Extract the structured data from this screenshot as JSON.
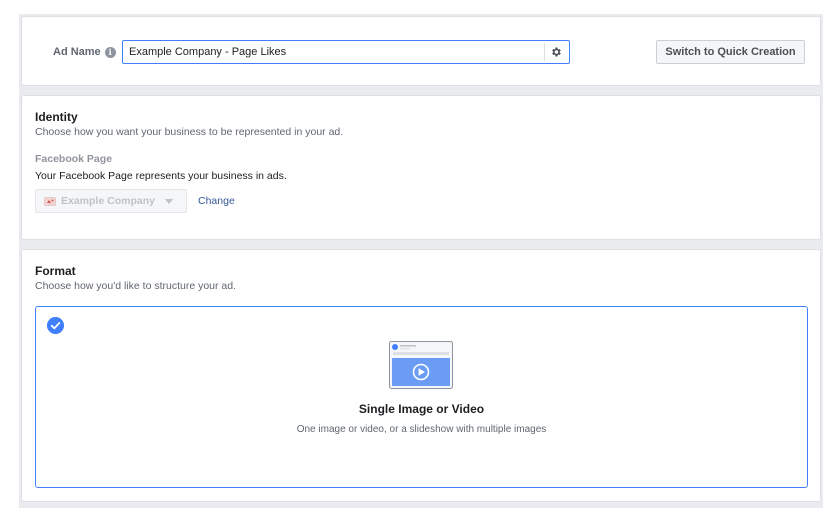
{
  "ad_name": {
    "label": "Ad Name",
    "value": "Example Company - Page Likes",
    "quick_creation_button": "Switch to Quick Creation"
  },
  "identity": {
    "title": "Identity",
    "subtitle": "Choose how you want your business to be represented in your ad.",
    "facebook_page_label": "Facebook Page",
    "facebook_page_description": "Your Facebook Page represents your business in ads.",
    "selected_page": "Example Company",
    "change_link": "Change"
  },
  "format": {
    "title": "Format",
    "subtitle": "Choose how you'd like to structure your ad.",
    "option": {
      "name": "Single Image or Video",
      "description": "One image or video, or a slideshow with multiple images",
      "selected": true
    }
  },
  "colors": {
    "accent": "#4080ff",
    "link": "#385898",
    "background": "#e9ebee"
  },
  "icons": [
    "info-icon",
    "gear-icon",
    "page-logo-icon",
    "caret-down-icon",
    "check-icon",
    "single-image-video-icon",
    "play-icon"
  ]
}
